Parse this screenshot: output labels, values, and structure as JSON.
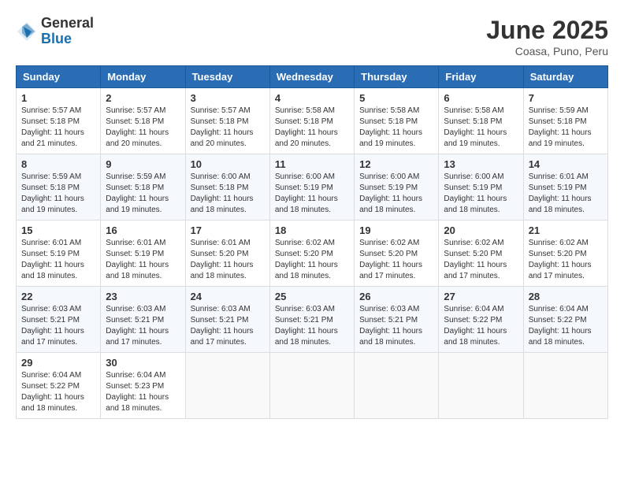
{
  "header": {
    "logo_general": "General",
    "logo_blue": "Blue",
    "month_title": "June 2025",
    "location": "Coasa, Puno, Peru"
  },
  "weekdays": [
    "Sunday",
    "Monday",
    "Tuesday",
    "Wednesday",
    "Thursday",
    "Friday",
    "Saturday"
  ],
  "weeks": [
    [
      {
        "day": "1",
        "info": "Sunrise: 5:57 AM\nSunset: 5:18 PM\nDaylight: 11 hours\nand 21 minutes."
      },
      {
        "day": "2",
        "info": "Sunrise: 5:57 AM\nSunset: 5:18 PM\nDaylight: 11 hours\nand 20 minutes."
      },
      {
        "day": "3",
        "info": "Sunrise: 5:57 AM\nSunset: 5:18 PM\nDaylight: 11 hours\nand 20 minutes."
      },
      {
        "day": "4",
        "info": "Sunrise: 5:58 AM\nSunset: 5:18 PM\nDaylight: 11 hours\nand 20 minutes."
      },
      {
        "day": "5",
        "info": "Sunrise: 5:58 AM\nSunset: 5:18 PM\nDaylight: 11 hours\nand 19 minutes."
      },
      {
        "day": "6",
        "info": "Sunrise: 5:58 AM\nSunset: 5:18 PM\nDaylight: 11 hours\nand 19 minutes."
      },
      {
        "day": "7",
        "info": "Sunrise: 5:59 AM\nSunset: 5:18 PM\nDaylight: 11 hours\nand 19 minutes."
      }
    ],
    [
      {
        "day": "8",
        "info": "Sunrise: 5:59 AM\nSunset: 5:18 PM\nDaylight: 11 hours\nand 19 minutes."
      },
      {
        "day": "9",
        "info": "Sunrise: 5:59 AM\nSunset: 5:18 PM\nDaylight: 11 hours\nand 19 minutes."
      },
      {
        "day": "10",
        "info": "Sunrise: 6:00 AM\nSunset: 5:18 PM\nDaylight: 11 hours\nand 18 minutes."
      },
      {
        "day": "11",
        "info": "Sunrise: 6:00 AM\nSunset: 5:19 PM\nDaylight: 11 hours\nand 18 minutes."
      },
      {
        "day": "12",
        "info": "Sunrise: 6:00 AM\nSunset: 5:19 PM\nDaylight: 11 hours\nand 18 minutes."
      },
      {
        "day": "13",
        "info": "Sunrise: 6:00 AM\nSunset: 5:19 PM\nDaylight: 11 hours\nand 18 minutes."
      },
      {
        "day": "14",
        "info": "Sunrise: 6:01 AM\nSunset: 5:19 PM\nDaylight: 11 hours\nand 18 minutes."
      }
    ],
    [
      {
        "day": "15",
        "info": "Sunrise: 6:01 AM\nSunset: 5:19 PM\nDaylight: 11 hours\nand 18 minutes."
      },
      {
        "day": "16",
        "info": "Sunrise: 6:01 AM\nSunset: 5:19 PM\nDaylight: 11 hours\nand 18 minutes."
      },
      {
        "day": "17",
        "info": "Sunrise: 6:01 AM\nSunset: 5:20 PM\nDaylight: 11 hours\nand 18 minutes."
      },
      {
        "day": "18",
        "info": "Sunrise: 6:02 AM\nSunset: 5:20 PM\nDaylight: 11 hours\nand 18 minutes."
      },
      {
        "day": "19",
        "info": "Sunrise: 6:02 AM\nSunset: 5:20 PM\nDaylight: 11 hours\nand 17 minutes."
      },
      {
        "day": "20",
        "info": "Sunrise: 6:02 AM\nSunset: 5:20 PM\nDaylight: 11 hours\nand 17 minutes."
      },
      {
        "day": "21",
        "info": "Sunrise: 6:02 AM\nSunset: 5:20 PM\nDaylight: 11 hours\nand 17 minutes."
      }
    ],
    [
      {
        "day": "22",
        "info": "Sunrise: 6:03 AM\nSunset: 5:21 PM\nDaylight: 11 hours\nand 17 minutes."
      },
      {
        "day": "23",
        "info": "Sunrise: 6:03 AM\nSunset: 5:21 PM\nDaylight: 11 hours\nand 17 minutes."
      },
      {
        "day": "24",
        "info": "Sunrise: 6:03 AM\nSunset: 5:21 PM\nDaylight: 11 hours\nand 17 minutes."
      },
      {
        "day": "25",
        "info": "Sunrise: 6:03 AM\nSunset: 5:21 PM\nDaylight: 11 hours\nand 18 minutes."
      },
      {
        "day": "26",
        "info": "Sunrise: 6:03 AM\nSunset: 5:21 PM\nDaylight: 11 hours\nand 18 minutes."
      },
      {
        "day": "27",
        "info": "Sunrise: 6:04 AM\nSunset: 5:22 PM\nDaylight: 11 hours\nand 18 minutes."
      },
      {
        "day": "28",
        "info": "Sunrise: 6:04 AM\nSunset: 5:22 PM\nDaylight: 11 hours\nand 18 minutes."
      }
    ],
    [
      {
        "day": "29",
        "info": "Sunrise: 6:04 AM\nSunset: 5:22 PM\nDaylight: 11 hours\nand 18 minutes."
      },
      {
        "day": "30",
        "info": "Sunrise: 6:04 AM\nSunset: 5:23 PM\nDaylight: 11 hours\nand 18 minutes."
      },
      {
        "day": "",
        "info": ""
      },
      {
        "day": "",
        "info": ""
      },
      {
        "day": "",
        "info": ""
      },
      {
        "day": "",
        "info": ""
      },
      {
        "day": "",
        "info": ""
      }
    ]
  ]
}
